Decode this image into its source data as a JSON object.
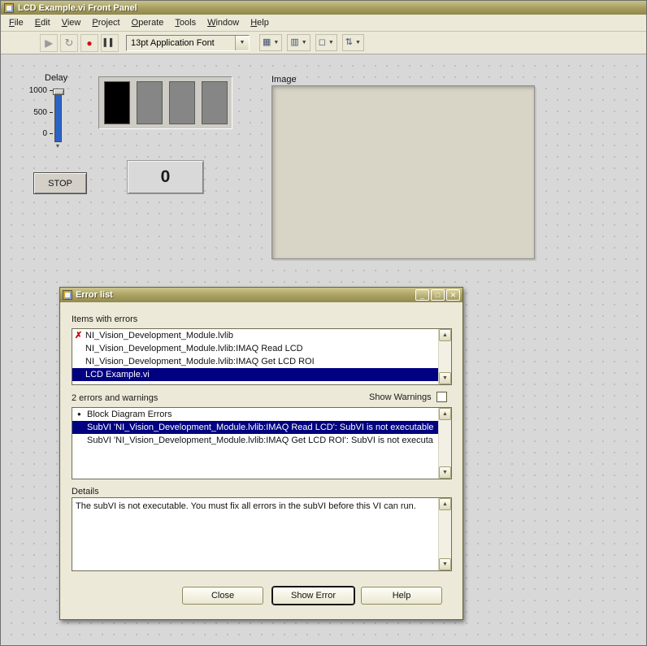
{
  "window": {
    "title": "LCD Example.vi Front Panel"
  },
  "menu": {
    "items": [
      "File",
      "Edit",
      "View",
      "Project",
      "Operate",
      "Tools",
      "Window",
      "Help"
    ]
  },
  "toolbar": {
    "font_selector": "13pt Application Font"
  },
  "panel": {
    "delay": {
      "label": "Delay",
      "ticks": [
        "1000",
        "500",
        "0"
      ]
    },
    "stop_button_label": "STOP",
    "numeric_value": "0",
    "image_label": "Image"
  },
  "error_dialog": {
    "title": "Error list",
    "items_with_errors_label": "Items with errors",
    "error_items": [
      {
        "text": "NI_Vision_Development_Module.lvlib"
      },
      {
        "text": "NI_Vision_Development_Module.lvlib:IMAQ Read LCD"
      },
      {
        "text": "NI_Vision_Development_Module.lvlib:IMAQ Get LCD ROI"
      },
      {
        "text": "LCD Example.vi"
      }
    ],
    "errors_count_label": "2 errors and warnings",
    "show_warnings_label": "Show Warnings",
    "detail_items": [
      {
        "text": "Block Diagram Errors"
      },
      {
        "text": "SubVI 'NI_Vision_Development_Module.lvlib:IMAQ Read LCD': SubVI is not executable"
      },
      {
        "text": "SubVI 'NI_Vision_Development_Module.lvlib:IMAQ Get LCD ROI': SubVI is not executa"
      }
    ],
    "details_label": "Details",
    "details_text": "The subVI is not executable. You must fix all errors in the subVI before this VI can run.",
    "buttons": {
      "close": "Close",
      "show_error": "Show Error",
      "help": "Help"
    },
    "colors": {
      "selection": "#000080",
      "error_mark": "#cc0000",
      "titlebar": "#a89f60"
    }
  }
}
